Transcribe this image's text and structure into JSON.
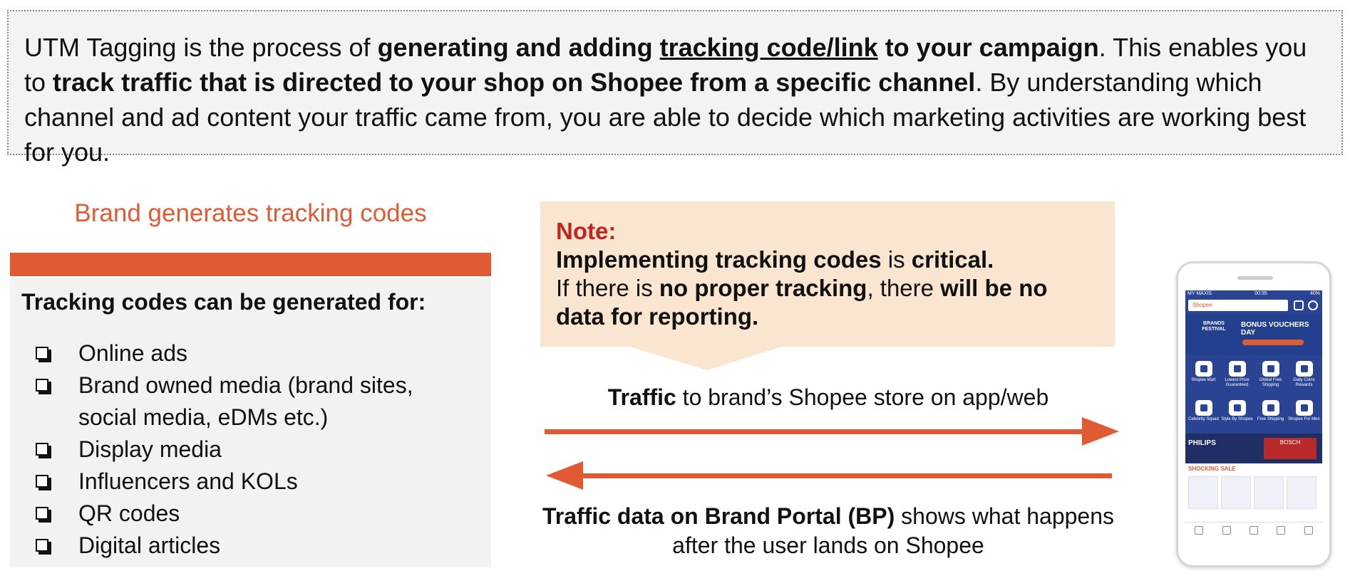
{
  "intro": {
    "seg1": "UTM Tagging is the process of ",
    "seg2": "generating and adding ",
    "seg3": "tracking code/link",
    "seg4": " to your campaign",
    "seg5": ". This enables you to ",
    "seg6": "track traffic that is directed to your shop on Shopee from a specific channel",
    "seg7": ". By understanding which channel and ad content your traffic came from, you are able to decide which marketing activities are working best for you."
  },
  "brand": {
    "title": "Brand generates tracking codes",
    "heading": "Tracking codes can be generated for:",
    "items": [
      "Online ads",
      "Brand owned media (brand sites, social media, eDMs etc.)",
      "Display media",
      "Influencers and KOLs",
      "QR codes",
      "Digital articles"
    ]
  },
  "note": {
    "label": "Note:",
    "l1a": "Implementing tracking codes",
    "l1b": " is ",
    "l1c": "critical.",
    "l2a": "If there is ",
    "l2b": "no proper tracking",
    "l2c": ", there ",
    "l2d": "will be no data for reporting."
  },
  "flow": {
    "top_bold": "Traffic",
    "top_rest": " to brand’s Shopee store on app/web",
    "bottom_bold": "Traffic data on Brand Portal (BP)",
    "bottom_rest": " shows what happens after the user lands on Shopee"
  },
  "phone": {
    "status_left": "MY MAXIS",
    "status_center": "00:35",
    "status_right": "40%",
    "search": "Shopee",
    "banner_left": "BRANDS FESTIVAL",
    "banner_right": "BONUS VOUCHERS DAY",
    "tiles": [
      "Shopee Mart",
      "Lowest Price Guaranteed",
      "Global Free Shipping",
      "Daily Coins Rewards",
      "Celebrity Squad",
      "Style By Shopee",
      "Free Shipping",
      "Shopee For Men"
    ],
    "promo_left": "PHILIPS",
    "promo_right": "BOSCH",
    "sale": "SHOCKING SALE"
  },
  "colors": {
    "accent": "#e05a33",
    "note_bg": "#f9e5d0",
    "note_label": "#c0261d",
    "panel_bg": "#f2f2f2"
  }
}
